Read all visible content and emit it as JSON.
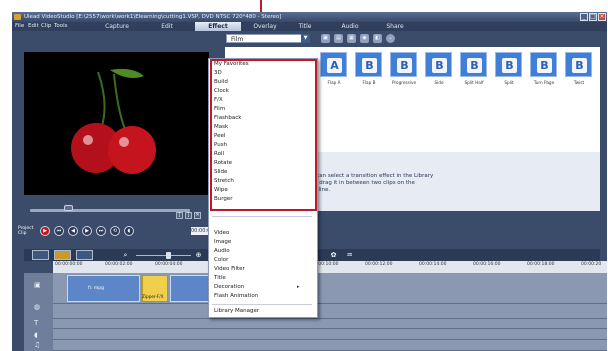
{
  "window": {
    "title": "Ulead VideoStudio [E:\\2557\\work\\work1\\Elearning\\cutting1.VSP, DVD NTSC 720*480 - Stereo]",
    "minimize": "_",
    "maximize": "□",
    "close": "×"
  },
  "menu": {
    "items": [
      "File",
      "Edit",
      "Clip",
      "Tools"
    ]
  },
  "steps": {
    "tabs": [
      "Capture",
      "Edit",
      "Effect",
      "Overlay",
      "Title",
      "Audio",
      "Share"
    ]
  },
  "library": {
    "selected": "Film",
    "thumbnails": [
      "Flap A",
      "Flap B",
      "Progressive",
      "Side",
      "Split Half",
      "Split",
      "Turn Page",
      "Twist"
    ],
    "info": "You can select a transition effect in the Library then drag it in between two clips on the Timeline."
  },
  "dropdown": {
    "group1": [
      "My Favorites",
      "3D",
      "Build",
      "Clock",
      "F/X",
      "Film",
      "Flashback",
      "Mask",
      "Peel",
      "Push",
      "Roll",
      "Rotate",
      "Slide",
      "Stretch",
      "Wipe",
      "Burger"
    ],
    "group2": [
      "Video",
      "Image",
      "Audio",
      "Color",
      "Video Filter",
      "Title",
      "Decoration",
      "Flash Animation"
    ],
    "group3": [
      "Library Manager"
    ],
    "submenu_arrow": "▸"
  },
  "player": {
    "label_project": "Project",
    "label_clip": "Clip",
    "timecode": "00:00:03:0",
    "trim_buttons": [
      "[",
      "]",
      "✕"
    ]
  },
  "timeline": {
    "ruler_ticks": [
      "00:00:00:00",
      "00:00:02:00",
      "00:00:04:00",
      "00:00:10:00",
      "00:00:12:00",
      "00:00:14:00",
      "00:00:16:00",
      "00:00:18:00",
      "00:00:20"
    ],
    "clip_label": "fr. mpg",
    "transition_label": "Zipper-F/X"
  },
  "icons": {
    "palette": {
      "accent_red": "#c0182c",
      "panel_blue": "#3a4c6a",
      "thumb_blue": "#3f7fd8",
      "transition_yellow": "#f0d04a"
    }
  }
}
